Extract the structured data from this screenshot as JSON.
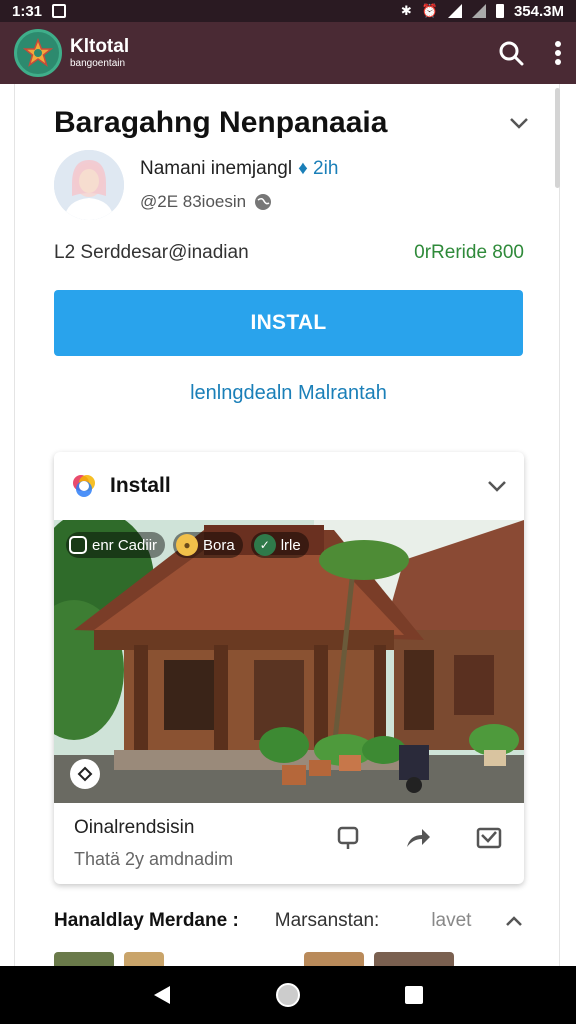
{
  "status_bar": {
    "time": "1:31",
    "right_text": "354.3M"
  },
  "app_bar": {
    "brand_name": "Kltotal",
    "brand_sub": "bangoentain"
  },
  "app": {
    "title": "Baragahng Nenpanaaia",
    "author_name": "Namani inemjangl",
    "author_tag": "♦ 2ih",
    "author_handle": "@2E 83ioesin",
    "meta_left": "L2 Serddesar@inadian",
    "meta_right": "0rReride 800",
    "install_label": "INSTAL",
    "sub_link": "lenlngdealn Malrantah"
  },
  "card": {
    "title": "Install",
    "chips": [
      "enr Cadiir",
      "Bora",
      "lrle"
    ],
    "footer_title": "Oinalrendsisin",
    "footer_sub": "Thatä 2y amdnadim"
  },
  "bottom_tabs": [
    "Hanaldlay Merdane :",
    "Marsanstan:",
    "lavet"
  ],
  "colors": {
    "accent": "#29a3ec",
    "app_bar": "#4a2a34",
    "meta_green": "#2f8a3a",
    "link": "#1a7fb8"
  }
}
